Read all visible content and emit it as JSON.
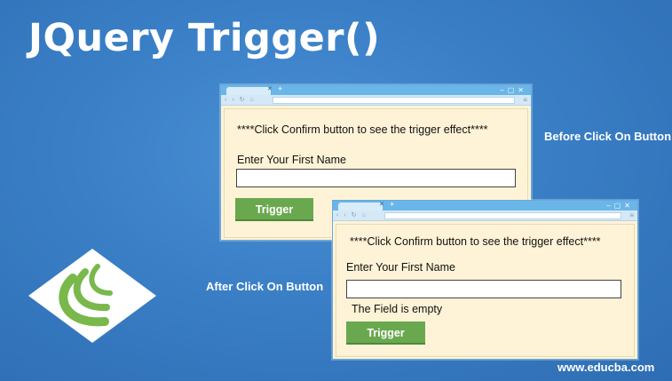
{
  "title": "JQuery Trigger()",
  "captions": {
    "before": "Before Click On Button",
    "after": "After Click On Button"
  },
  "site": "www.educba.com",
  "browser_before": {
    "info": "****Click Confirm button to see the trigger effect****",
    "label": "Enter Your First Name",
    "input_value": "",
    "button": "Trigger"
  },
  "browser_after": {
    "info": "****Click Confirm button to see the trigger effect****",
    "label": "Enter Your First Name",
    "input_value": "",
    "status": "The Field is empty",
    "button": "Trigger"
  },
  "colors": {
    "background": "#3a7fc6",
    "browser_chrome": "#6bb6e8",
    "page_bg": "#fef3d6",
    "button": "#6aa84f",
    "logo_green": "#79b84a"
  },
  "icons": [
    "jquery-logo-icon",
    "back-icon",
    "forward-icon",
    "refresh-icon",
    "home-icon",
    "menu-icon",
    "close-icon",
    "minimize-icon",
    "maximize-icon"
  ]
}
